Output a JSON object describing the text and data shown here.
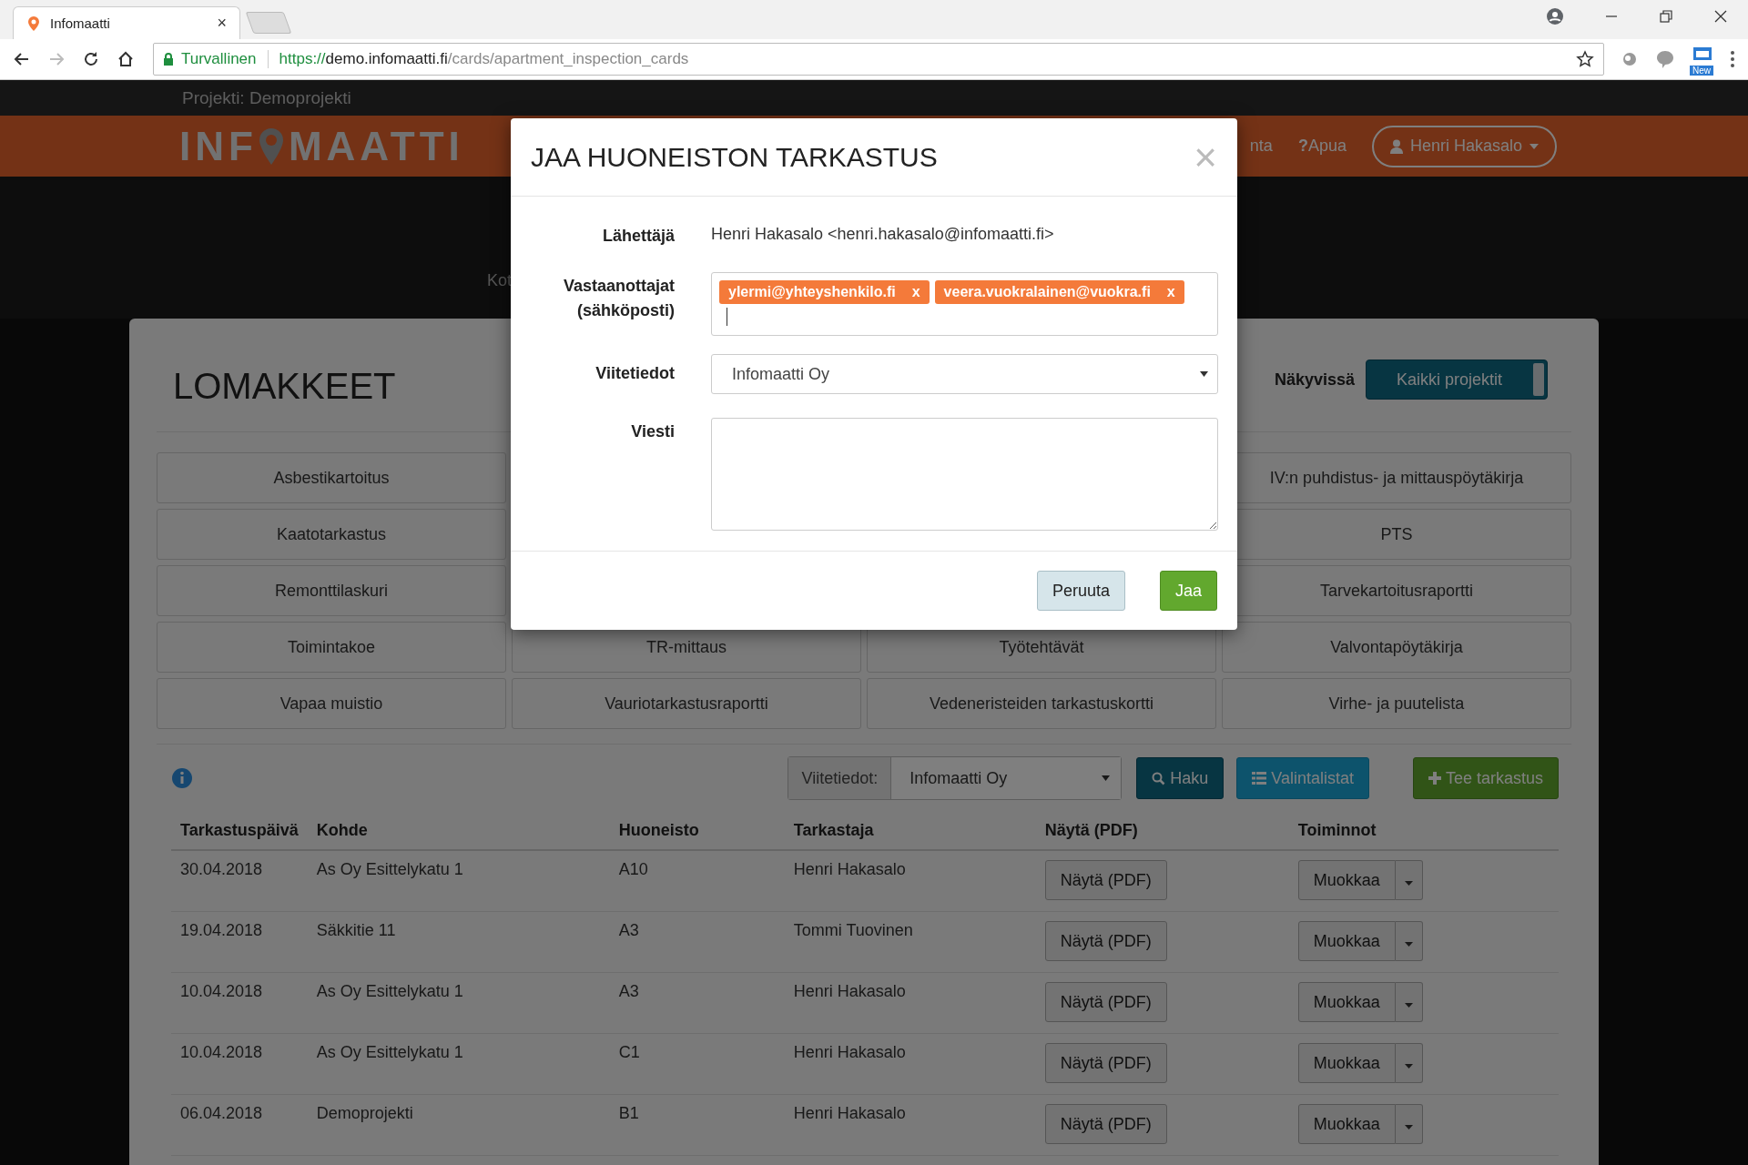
{
  "browser": {
    "tab": {
      "title": "Infomaatti",
      "close": "×"
    },
    "address": {
      "security": "Turvallinen",
      "scheme": "https://",
      "host": "demo.infomaatti.fi",
      "path": "/cards/apartment_inspection_cards"
    },
    "extension_badge": "New"
  },
  "project_bar": {
    "label": "Projekti: Demoprojekti"
  },
  "header": {
    "logo_left": "INF",
    "logo_right": "MAATTI",
    "nav_partial": "nta",
    "help": {
      "icon": "?",
      "label": "Apua"
    },
    "user": "Henri Hakasalo"
  },
  "hero": {
    "breadcrumb_partial": "Kot"
  },
  "forms": {
    "title": "LOMAKKEET",
    "visibility_label": "Näkyvissä",
    "visibility_button": "Kaikki projektit",
    "grid": [
      [
        "Asbestikartoitus",
        "IV:n puhdistus- ja mittauspöytäkirja"
      ],
      [
        "Kaatotarkastus",
        "PTS"
      ],
      [
        "Remonttilaskuri",
        "Tarvekartoitusraportti"
      ],
      [
        "Toimintakoe",
        "TR-mittaus",
        "Työtehtävät",
        "Valvontapöytäkirja"
      ],
      [
        "Vapaa muistio",
        "Vauriotarkastusraportti",
        "Vedeneristeiden tarkastuskortti",
        "Virhe- ja puutelista"
      ]
    ]
  },
  "filter": {
    "addon": "Viitetiedot:",
    "value": "Infomaatti Oy",
    "search_button": "Haku",
    "lists_button": "Valintalistat",
    "new_button": "Tee tarkastus"
  },
  "table": {
    "columns": [
      "Tarkastuspäivä",
      "Kohde",
      "Huoneisto",
      "Tarkastaja",
      "Näytä (PDF)",
      "Toiminnot"
    ],
    "rows": [
      {
        "date": "30.04.2018",
        "target": "As Oy Esittelykatu 1",
        "apartment": "A10",
        "inspector": "Henri Hakasalo",
        "pdf": "Näytä (PDF)",
        "edit": "Muokkaa"
      },
      {
        "date": "19.04.2018",
        "target": "Säkkitie 11",
        "apartment": "A3",
        "inspector": "Tommi Tuovinen",
        "pdf": "Näytä (PDF)",
        "edit": "Muokkaa"
      },
      {
        "date": "10.04.2018",
        "target": "As Oy Esittelykatu 1",
        "apartment": "A3",
        "inspector": "Henri Hakasalo",
        "pdf": "Näytä (PDF)",
        "edit": "Muokkaa"
      },
      {
        "date": "10.04.2018",
        "target": "As Oy Esittelykatu 1",
        "apartment": "C1",
        "inspector": "Henri Hakasalo",
        "pdf": "Näytä (PDF)",
        "edit": "Muokkaa"
      },
      {
        "date": "06.04.2018",
        "target": "Demoprojekti",
        "apartment": "B1",
        "inspector": "Henri Hakasalo",
        "pdf": "Näytä (PDF)",
        "edit": "Muokkaa"
      }
    ]
  },
  "modal": {
    "title": "JAA HUONEISTON TARKASTUS",
    "close": "×",
    "sender_label": "Lähettäjä",
    "sender": "Henri Hakasalo <henri.hakasalo@infomaatti.fi>",
    "recipients_label": "Vastaanottajat\n(sähköposti)",
    "recipients": [
      {
        "email": "ylermi@yhteyshenkilo.fi",
        "remove": "x"
      },
      {
        "email": "veera.vuokralainen@vuokra.fi",
        "remove": "x"
      }
    ],
    "reference_label": "Viitetiedot",
    "reference": "Infomaatti Oy",
    "message_label": "Viesti",
    "cancel": "Peruuta",
    "submit": "Jaa"
  }
}
